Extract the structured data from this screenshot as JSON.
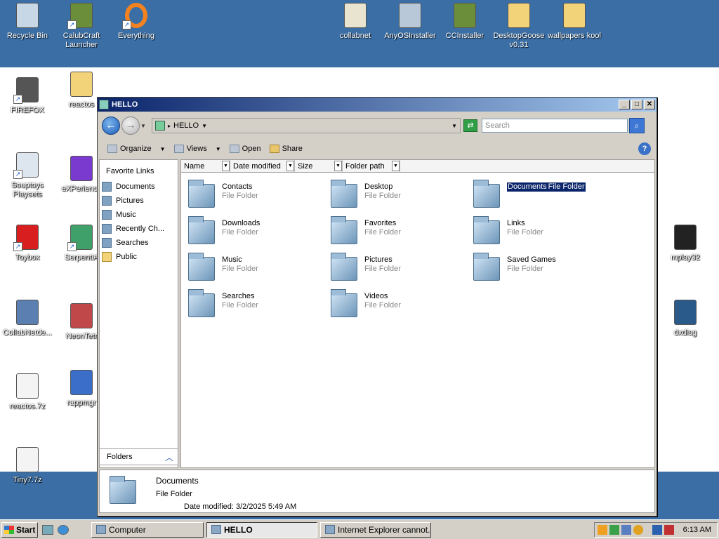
{
  "desktop": {
    "icons": [
      {
        "label": "Recycle Bin",
        "icon": "recycle-bin-icon",
        "shortcut": false
      },
      {
        "label": "CalubCraft\nLauncher",
        "icon": "minecraft-block-icon",
        "shortcut": true
      },
      {
        "label": "Everything",
        "icon": "everything-ring-icon",
        "shortcut": true
      },
      {
        "label": "collabnet",
        "icon": "certificate-icon",
        "shortcut": false
      },
      {
        "label": "AnyOSInstaller",
        "icon": "installer-icon",
        "shortcut": false
      },
      {
        "label": "CCInstaller",
        "icon": "minecraft-block-icon",
        "shortcut": false
      },
      {
        "label": "DesktopGoose\nv0.31",
        "icon": "folder-icon",
        "shortcut": false
      },
      {
        "label": "wallpapers kool",
        "icon": "folder-icon",
        "shortcut": false
      },
      {
        "label": "FIREFOX",
        "icon": "raccoon-icon",
        "shortcut": true
      },
      {
        "label": "reactos",
        "icon": "folder-icon",
        "shortcut": false
      },
      {
        "label": "Souptoys\nPlaysets",
        "icon": "app-window-icon",
        "shortcut": true
      },
      {
        "label": "eXPerience",
        "icon": "spectrum-icon",
        "shortcut": false
      },
      {
        "label": "Toybox",
        "icon": "toybox-s-icon",
        "shortcut": true
      },
      {
        "label": "SerpentiA",
        "icon": "serpent-icon",
        "shortcut": true
      },
      {
        "label": "CollabNetde...",
        "icon": "computer-shield-icon",
        "shortcut": false
      },
      {
        "label": "NeonTetr",
        "icon": "fish-icon",
        "shortcut": false
      },
      {
        "label": "reactos.7z",
        "icon": "file-icon",
        "shortcut": false
      },
      {
        "label": "rappmgr",
        "icon": "cabinet-icon",
        "shortcut": false
      },
      {
        "label": "Tiny7.7z",
        "icon": "file-icon",
        "shortcut": false
      },
      {
        "label": "mplay32",
        "icon": "clapperboard-icon",
        "shortcut": false
      },
      {
        "label": "dxdiag",
        "icon": "monitor-play-icon",
        "shortcut": false
      }
    ]
  },
  "window": {
    "title": "HELLO",
    "address": "HELLO",
    "search_placeholder": "Search",
    "toolbar": {
      "organize": "Organize",
      "views": "Views",
      "open": "Open",
      "share": "Share"
    },
    "favorite_links_header": "Favorite Links",
    "favorite_links": [
      "Documents",
      "Pictures",
      "Music",
      "Recently Ch...",
      "Searches",
      "Public"
    ],
    "folders_label": "Folders",
    "columns": [
      "Name",
      "Date modified",
      "Size",
      "Folder path"
    ],
    "items": [
      {
        "name": "Contacts",
        "type": "File Folder",
        "selected": false
      },
      {
        "name": "Desktop",
        "type": "File Folder",
        "selected": false
      },
      {
        "name": "Documents",
        "type": "File Folder",
        "selected": true
      },
      {
        "name": "Downloads",
        "type": "File Folder",
        "selected": false
      },
      {
        "name": "Favorites",
        "type": "File Folder",
        "selected": false
      },
      {
        "name": "Links",
        "type": "File Folder",
        "selected": false
      },
      {
        "name": "Music",
        "type": "File Folder",
        "selected": false
      },
      {
        "name": "Pictures",
        "type": "File Folder",
        "selected": false
      },
      {
        "name": "Saved Games",
        "type": "File Folder",
        "selected": false
      },
      {
        "name": "Searches",
        "type": "File Folder",
        "selected": false
      },
      {
        "name": "Videos",
        "type": "File Folder",
        "selected": false
      }
    ],
    "details": {
      "name": "Documents",
      "type": "File Folder",
      "date_modified_label": "Date modified:",
      "date_modified": "3/2/2025 5:49 AM"
    }
  },
  "taskbar": {
    "start": "Start",
    "tasks": [
      {
        "label": "Computer",
        "active": false
      },
      {
        "label": "HELLO",
        "active": true
      },
      {
        "label": "Internet Explorer cannot...",
        "active": false
      }
    ],
    "clock": "6:13 AM"
  },
  "colors": {
    "desktop_blue": "#3a6ea5",
    "selection": "#0a246a"
  }
}
